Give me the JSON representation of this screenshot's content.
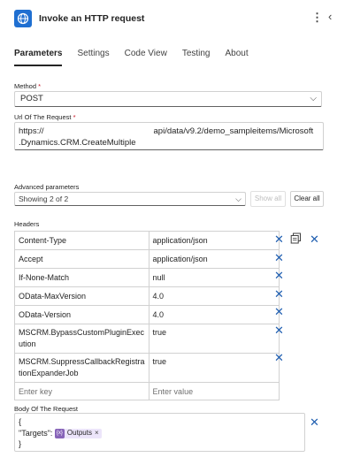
{
  "header": {
    "title": "Invoke an HTTP request",
    "app_icon": "globe-icon",
    "more_icon": "⋮",
    "collapse_icon": "‹",
    "accent": "#1f6fd1"
  },
  "tabs": [
    {
      "label": "Parameters",
      "active": true
    },
    {
      "label": "Settings"
    },
    {
      "label": "Code View"
    },
    {
      "label": "Testing"
    },
    {
      "label": "About"
    }
  ],
  "method": {
    "label": "Method",
    "required_mark": "*",
    "value": "POST"
  },
  "url": {
    "label": "Url Of The Request",
    "required_mark": "*",
    "line1_start": "https://",
    "line1_end": "api/data/v9.2/demo_sampleitems/Microsoft",
    "line2": ".Dynamics.CRM.CreateMultiple"
  },
  "advanced": {
    "label": "Advanced parameters",
    "value": "Showing 2 of 2",
    "show_all": "Show all",
    "clear_all": "Clear all"
  },
  "headers": {
    "label": "Headers",
    "rows": [
      {
        "key": "Content-Type",
        "value": "application/json"
      },
      {
        "key": "Accept",
        "value": "application/json"
      },
      {
        "key": "If-None-Match",
        "value": "null"
      },
      {
        "key": "OData-MaxVersion",
        "value": "4.0"
      },
      {
        "key": "OData-Version",
        "value": "4.0"
      },
      {
        "key": "MSCRM.BypassCustomPluginExecution",
        "key_line1": "MSCRM.BypassCustomPluginExec",
        "key_line2": "ution",
        "value": "true"
      },
      {
        "key": "MSCRM.SuppressCallbackRegistrationExpanderJob",
        "key_line1": "MSCRM.SuppressCallbackRegistra",
        "key_line2": "tionExpanderJob",
        "value": "true"
      }
    ],
    "key_placeholder": "Enter key",
    "value_placeholder": "Enter value",
    "delete_icon": "✕"
  },
  "body": {
    "label": "Body Of The Request",
    "line1": "{",
    "line2_prefix": "\"Targets\":",
    "token_label": "Outputs",
    "token_close": "×",
    "line3": "}",
    "token_color": "#8764b8"
  }
}
